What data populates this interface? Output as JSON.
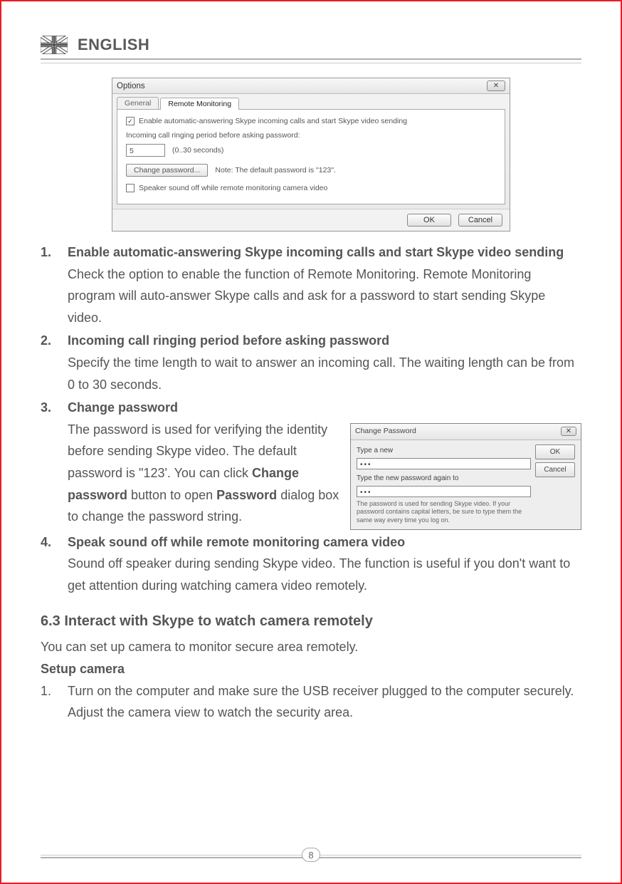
{
  "header": {
    "language": "ENGLISH"
  },
  "options_dialog": {
    "title": "Options",
    "tab_general": "General",
    "tab_remote": "Remote Monitoring",
    "chk_enable": "Enable automatic-answering Skype incoming calls and start Skype video sending",
    "label_ringing": "Incoming call ringing period before asking password:",
    "ringing_value": "5",
    "ringing_hint": "(0..30 seconds)",
    "btn_change_pw": "Change password...",
    "note_default_pw": "Note: The default password is \"123\".",
    "chk_speaker": "Speaker sound off while remote monitoring camera video",
    "btn_ok": "OK",
    "btn_cancel": "Cancel"
  },
  "list": {
    "n1": "1.",
    "t1": "Enable automatic-answering Skype incoming calls and start Skype video sending",
    "d1a": "Check the option to enable the function of Remote Monitoring.",
    "d1b": "Remote Monitoring program will auto-answer Skype calls and ask for a password to start sending Skype video.",
    "n2": "2.",
    "t2": "Incoming call ringing period before asking password",
    "d2": "Specify the time length to wait to answer an incoming call. The waiting length can be from 0 to 30 seconds.",
    "n3": "3.",
    "t3": "Change password",
    "d3_pre": "The password is used for verifying the identity before sending Skype video. The default password is \"123'. You can click ",
    "d3_b1": "Change password",
    "d3_mid": " button to open ",
    "d3_b2": "Password",
    "d3_post": " dialog box to change the password string.",
    "n4": "4.",
    "t4": "Speak sound off while remote monitoring camera video",
    "d4": "Sound off speaker during sending Skype video. The function is useful if you don't want to get attention during watching camera video remotely."
  },
  "cp_dialog": {
    "title": "Change Password",
    "label1": "Type a new",
    "val1": "•••",
    "label2": "Type the new password again to",
    "val2": "•••",
    "note": "The password is used for sending Skype video. If your password contains capital letters, be sure to type them the same way every time you log on.",
    "btn_ok": "OK",
    "btn_cancel": "Cancel"
  },
  "section63": {
    "heading": "6.3 Interact with Skype to watch camera remotely",
    "intro": "You can set up camera to monitor secure area remotely.",
    "setup_heading": "Setup camera",
    "step1_num": "1.",
    "step1": "Turn on the computer and make sure the USB receiver plugged to the computer securely. Adjust the camera view to watch the security area."
  },
  "page_number": "8"
}
